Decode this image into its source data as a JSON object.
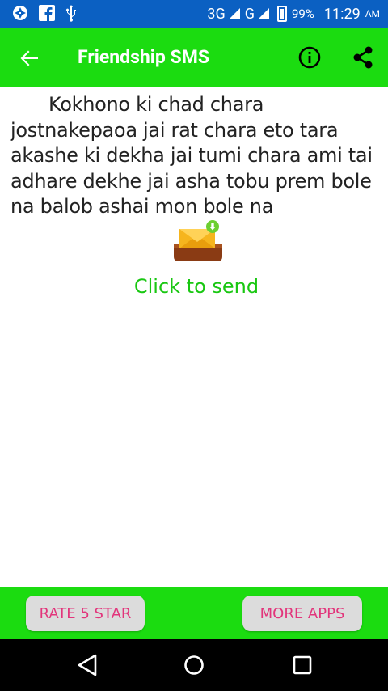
{
  "status_bar": {
    "network_3g": "3G",
    "network_g": "G",
    "battery_percent": "99%",
    "time": "11:29",
    "ampm": "AM",
    "icons": [
      "aperture-icon",
      "facebook-icon",
      "usb-icon",
      "signal-icon",
      "battery-icon"
    ]
  },
  "toolbar": {
    "title": "Friendship SMS",
    "icons": [
      "back-arrow-icon",
      "info-icon",
      "share-icon"
    ]
  },
  "content": {
    "message": "Kokhono ki chad chara jostnakepaoa jai rat chara eto tara akashe ki dekha jai tumi chara ami tai adhare dekhe jai asha tobu prem bole na balob ashai mon bole na",
    "send_label": "Click to send",
    "send_icon": "mail-download-icon"
  },
  "bottom_bar": {
    "rate_label": "RATE 5 STAR",
    "more_label": "MORE APPS"
  },
  "colors": {
    "status_bar": "#0b60c2",
    "accent_green": "#1bdc10",
    "send_text": "#19c712",
    "button_text": "#e2357b",
    "button_bg": "#dcdcdc"
  }
}
